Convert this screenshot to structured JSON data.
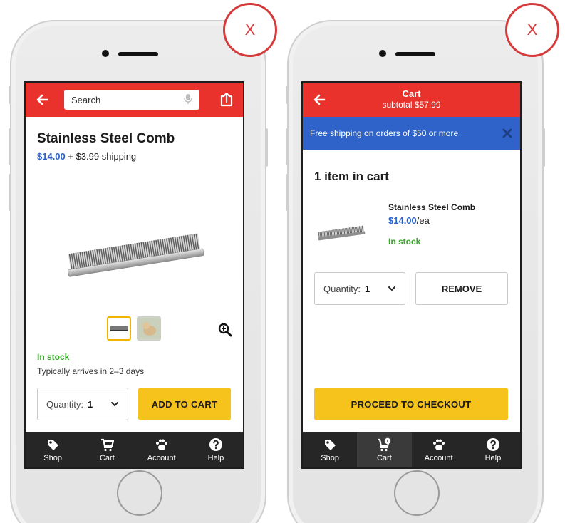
{
  "close_marker": "X",
  "product_screen": {
    "search_placeholder": "Search",
    "title": "Stainless Steel Comb",
    "price": "$14.00",
    "shipping": " + $3.99 shipping",
    "stock": "In stock",
    "arrival": "Typically arrives in 2–3 days",
    "quantity_label": "Quantity:",
    "quantity_value": "1",
    "add_to_cart": "ADD TO CART"
  },
  "cart_screen": {
    "title": "Cart",
    "subtotal": "subtotal $57.99",
    "banner": "Free shipping on orders of $50 or more",
    "count_heading": "1 item in cart",
    "item_name": "Stainless Steel Comb",
    "item_price": "$14.00",
    "item_unit": "/ea",
    "item_stock": "In stock",
    "quantity_label": "Quantity:",
    "quantity_value": "1",
    "remove": "REMOVE",
    "checkout": "PROCEED TO CHECKOUT"
  },
  "tabbar": {
    "shop": "Shop",
    "cart": "Cart",
    "account": "Account",
    "help": "Help"
  },
  "colors": {
    "header_red": "#e8322b",
    "banner_blue": "#2f63c9",
    "price_blue": "#2d63c8",
    "cta_yellow": "#f6c21c",
    "stock_green": "#3aa32b",
    "tabbar_dark": "#262626",
    "close_marker_red": "#d63b3b"
  },
  "icons": [
    "back-arrow-icon",
    "microphone-icon",
    "share-icon",
    "zoom-in-icon",
    "chevron-down-icon",
    "close-icon",
    "tag-icon",
    "cart-icon",
    "paw-icon",
    "help-icon"
  ]
}
